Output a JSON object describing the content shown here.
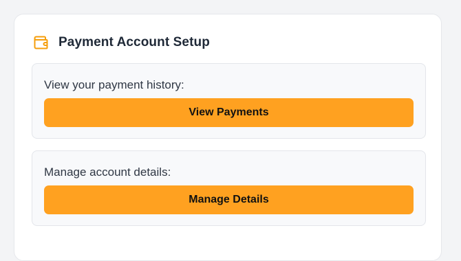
{
  "header": {
    "title": "Payment Account Setup",
    "icon": "wallet-icon"
  },
  "sections": [
    {
      "label": "View your payment history:",
      "button_label": "View Payments"
    },
    {
      "label": "Manage account details:",
      "button_label": "Manage Details"
    }
  ],
  "colors": {
    "accent": "#ffa120",
    "icon": "#f59e0b",
    "title": "#1f2937",
    "page_background": "#f3f4f6",
    "card_background": "#ffffff",
    "section_background": "#f8f9fb"
  }
}
